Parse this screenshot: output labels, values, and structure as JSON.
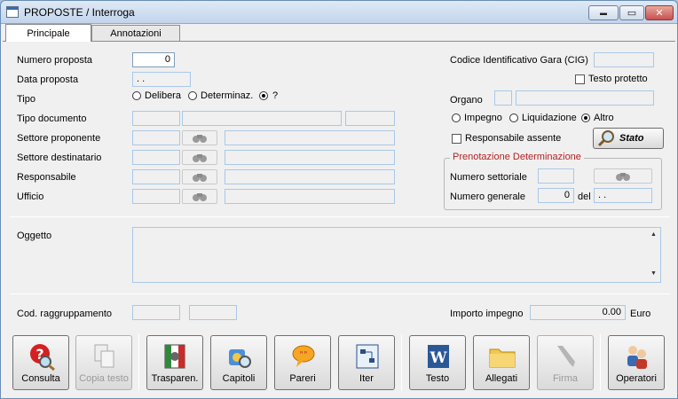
{
  "window": {
    "title": "PROPOSTE / Interroga",
    "minimize_glyph": "▬",
    "restore_glyph": "▭",
    "close_glyph": "✕"
  },
  "tabs": [
    {
      "label": "Principale",
      "active": true
    },
    {
      "label": "Annotazioni",
      "active": false
    }
  ],
  "form": {
    "numero_proposta": {
      "label": "Numero proposta",
      "value": "0"
    },
    "data_proposta": {
      "label": "Data proposta",
      "value": " .  ."
    },
    "tipo": {
      "label": "Tipo",
      "options": [
        {
          "label": "Delibera",
          "selected": false
        },
        {
          "label": "Determinaz.",
          "selected": false
        },
        {
          "label": "?",
          "selected": true
        }
      ]
    },
    "tipo_documento": {
      "label": "Tipo documento"
    },
    "settore_proponente": {
      "label": "Settore proponente"
    },
    "settore_destinatario": {
      "label": "Settore destinatario"
    },
    "responsabile": {
      "label": "Responsabile"
    },
    "ufficio": {
      "label": "Ufficio"
    },
    "cig": {
      "label": "Codice Identificativo Gara (CIG)",
      "value": ""
    },
    "testo_protetto": {
      "label": "Testo protetto",
      "checked": false
    },
    "organo": {
      "label": "Organo"
    },
    "impegno_tipo": {
      "options": [
        {
          "label": "Impegno",
          "selected": false
        },
        {
          "label": "Liquidazione",
          "selected": false
        },
        {
          "label": "Altro",
          "selected": true
        }
      ]
    },
    "responsabile_assente": {
      "label": "Responsabile assente",
      "checked": false
    },
    "stato_button": "Stato",
    "prenotazione": {
      "title": "Prenotazione Determinazione",
      "numero_settoriale_label": "Numero settoriale",
      "numero_generale_label": "Numero generale",
      "numero_generale_value": "0",
      "del_label": "del",
      "del_value": " .  ."
    },
    "oggetto": {
      "label": "Oggetto",
      "value": ""
    },
    "cod_raggruppamento": {
      "label": "Cod. raggruppamento"
    },
    "importo_impegno": {
      "label": "Importo impegno",
      "value": "0.00",
      "currency": "Euro"
    }
  },
  "toolbar": [
    {
      "label": "Consulta",
      "enabled": true
    },
    {
      "label": "Copia testo",
      "enabled": false
    },
    {
      "label": "Trasparen.",
      "enabled": true
    },
    {
      "label": "Capitoli",
      "enabled": true
    },
    {
      "label": "Pareri",
      "enabled": true
    },
    {
      "label": "Iter",
      "enabled": true
    },
    {
      "label": "Testo",
      "enabled": true
    },
    {
      "label": "Allegati",
      "enabled": true
    },
    {
      "label": "Firma",
      "enabled": false
    },
    {
      "label": "Operatori",
      "enabled": true
    }
  ],
  "colors": {
    "field_border": "#a9c8e8",
    "group_title": "#b22222",
    "close_button": "#c75050"
  }
}
